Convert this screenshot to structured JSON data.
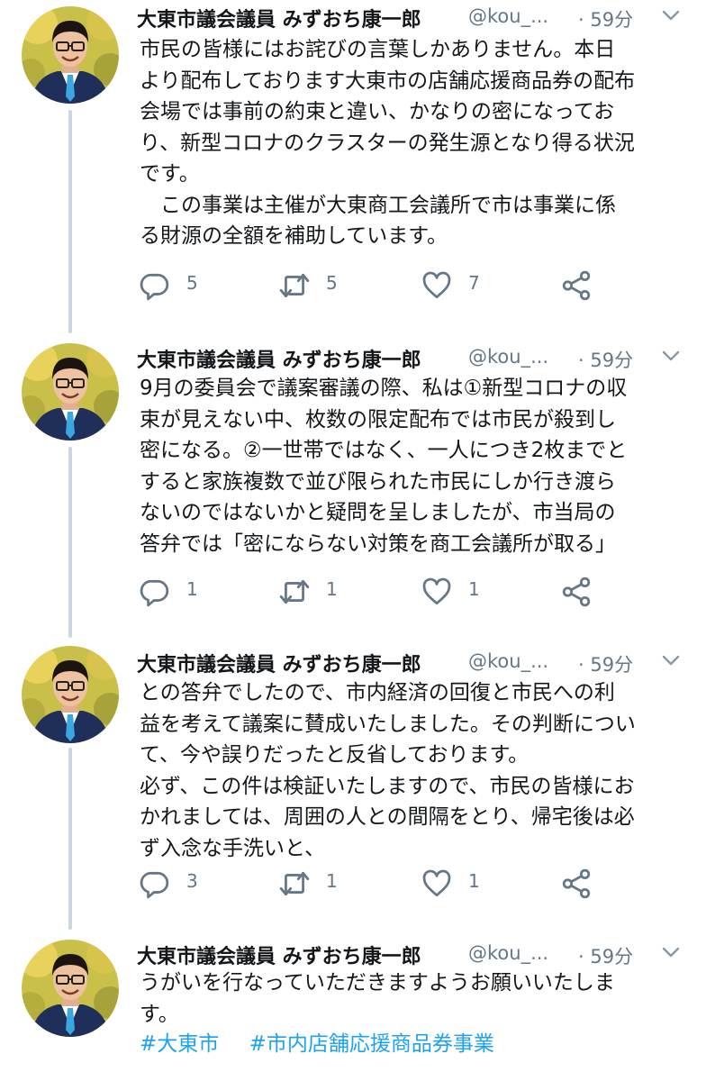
{
  "author": {
    "display_name": "大東市議会議員 みずおち康一郎",
    "handle": "@kou_..."
  },
  "colors": {
    "text": "#14171a",
    "secondary": "#657786",
    "link": "#1da1f2",
    "thread_line": "#ccd6dd"
  },
  "tweets": [
    {
      "time": "· 59分",
      "lines": [
        "市民の皆様にはお詫びの言葉しかありません。本日",
        "より配布しております大東市の店舗応援商品券の配布",
        "会場では事前の約束と違い、かなりの密になってお",
        "り、新型コロナのクラスターの発生源となり得る状況",
        "です。",
        "　この事業は主催が大東商工会議所で市は事業に係",
        "る財源の全額を補助しています。"
      ],
      "reply_count": "5",
      "retweet_count": "5",
      "like_count": "7"
    },
    {
      "time": "· 59分",
      "lines": [
        "9月の委員会で議案審議の際、私は①新型コロナの収",
        "束が見えない中、枚数の限定配布では市民が殺到し",
        "密になる。②一世帯ではなく、一人につき2枚までと",
        "すると家族複数で並び限られた市民にしか行き渡ら",
        "ないのではないかと疑問を呈しましたが、市当局の",
        "答弁では「密にならない対策を商工会議所が取る」"
      ],
      "reply_count": "1",
      "retweet_count": "1",
      "like_count": "1"
    },
    {
      "time": "· 59分",
      "lines": [
        "との答弁でしたので、市内経済の回復と市民への利",
        "益を考えて議案に賛成いたしました。その判断につい",
        "て、今や誤りだったと反省しております。",
        "必ず、この件は検証いたしますので、市民の皆様にお",
        "かれましては、周囲の人との間隔をとり、帰宅後は必",
        "ず入念な手洗いと、"
      ],
      "reply_count": "3",
      "retweet_count": "1",
      "like_count": "1"
    },
    {
      "time": "· 59分",
      "lines": [
        "うがいを行なっていただきますようお願いいたしま",
        "す。"
      ],
      "hashtags": [
        "#大東市",
        "#市内店舗応援商品券事業"
      ]
    }
  ]
}
